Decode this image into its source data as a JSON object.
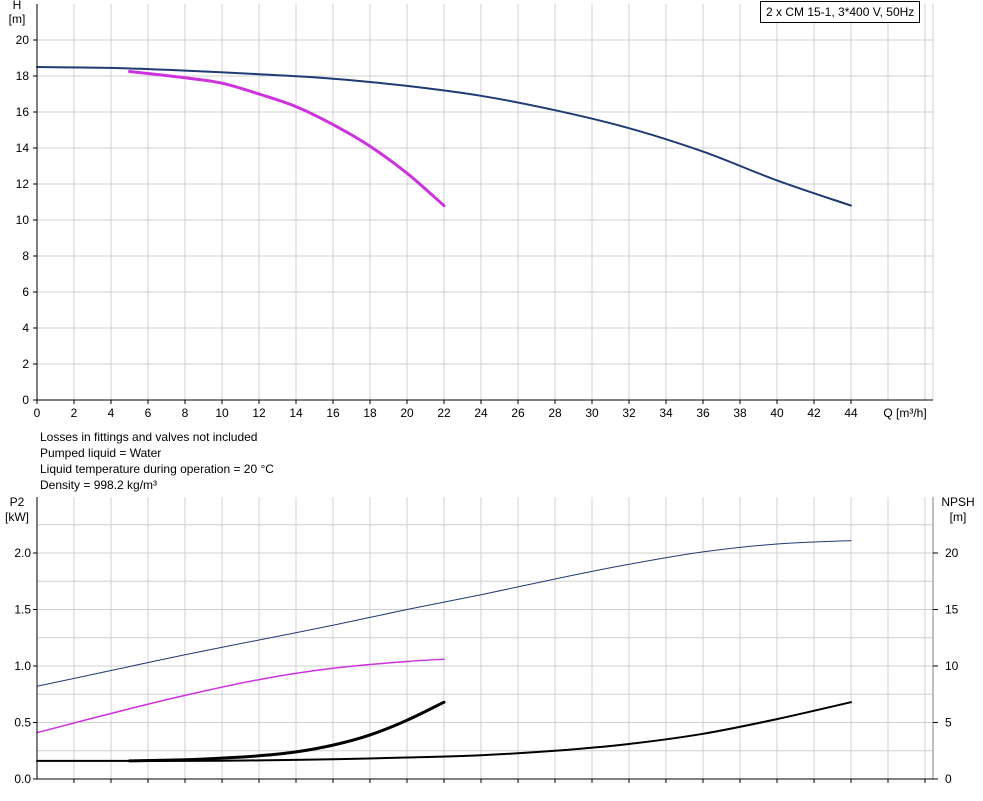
{
  "chart_data": [
    {
      "type": "line",
      "title": "2 x CM 15-1, 3*400 V, 50Hz",
      "ylabel": "H",
      "yunit": "[m]",
      "xlabel": "Q [m³/h]",
      "xlim": [
        0,
        48
      ],
      "ylim": [
        0,
        20
      ],
      "x_ticks": [
        0,
        2,
        4,
        6,
        8,
        10,
        12,
        14,
        16,
        18,
        20,
        22,
        24,
        26,
        28,
        30,
        32,
        34,
        36,
        38,
        40,
        42,
        44
      ],
      "y_ticks": [
        0,
        2,
        4,
        6,
        8,
        10,
        12,
        14,
        16,
        18,
        20
      ],
      "grid": true,
      "series": [
        {
          "color": "#1f3b73",
          "x": [
            0,
            4,
            8,
            12,
            16,
            20,
            24,
            28,
            32,
            36,
            40,
            44
          ],
          "y": [
            18.5,
            18.45,
            18.3,
            18.1,
            17.85,
            17.45,
            16.9,
            16.1,
            15.1,
            13.8,
            12.2,
            10.8
          ]
        },
        {
          "color": "#cc33dd",
          "x": [
            5,
            8,
            10,
            12,
            14,
            16,
            18,
            20,
            22
          ],
          "y": [
            18.25,
            17.9,
            17.6,
            17.0,
            16.3,
            15.3,
            14.1,
            12.6,
            10.8
          ]
        }
      ]
    },
    {
      "type": "line",
      "ylabel": "P2",
      "yunit": "[kW]",
      "ylabel_right": "NPSH",
      "yunit_right": "[m]",
      "xlim": [
        0,
        48
      ],
      "ylim": [
        0,
        2.4
      ],
      "ylim_right": [
        0,
        24
      ],
      "y_ticks": [
        "0.0",
        "0.5",
        "1.0",
        "1.5",
        "2.0"
      ],
      "y_ticks_right": [
        "0",
        "5",
        "10",
        "15",
        "20"
      ],
      "grid": true,
      "series": [
        {
          "color": "#1f3b73",
          "axis": "left",
          "x": [
            0,
            4,
            8,
            12,
            16,
            20,
            24,
            28,
            32,
            36,
            40,
            44
          ],
          "y": [
            0.82,
            0.96,
            1.1,
            1.23,
            1.36,
            1.5,
            1.63,
            1.77,
            1.9,
            2.01,
            2.08,
            2.11
          ]
        },
        {
          "color": "#cc33dd",
          "axis": "left",
          "x": [
            0,
            4,
            8,
            12,
            16,
            20,
            22
          ],
          "y": [
            0.41,
            0.58,
            0.74,
            0.88,
            0.98,
            1.04,
            1.06
          ]
        },
        {
          "color": "#000000",
          "axis": "right",
          "x": [
            0,
            4,
            8,
            12,
            16,
            20,
            24,
            28,
            32,
            36,
            40,
            44
          ],
          "y": [
            1.6,
            1.6,
            1.6,
            1.65,
            1.75,
            1.9,
            2.1,
            2.5,
            3.1,
            4.0,
            5.3,
            6.8
          ]
        },
        {
          "color": "#000000",
          "axis": "right",
          "x": [
            5,
            8,
            10,
            12,
            14,
            16,
            18,
            20,
            22
          ],
          "y": [
            1.6,
            1.7,
            1.85,
            2.05,
            2.4,
            3.0,
            3.9,
            5.2,
            6.8
          ]
        }
      ]
    }
  ],
  "notes": {
    "line1": "Losses in fittings and valves not included",
    "line2": "Pumped liquid = Water",
    "line3": "Liquid temperature during operation = 20 °C",
    "line4": "Density = 998.2 kg/m³"
  }
}
